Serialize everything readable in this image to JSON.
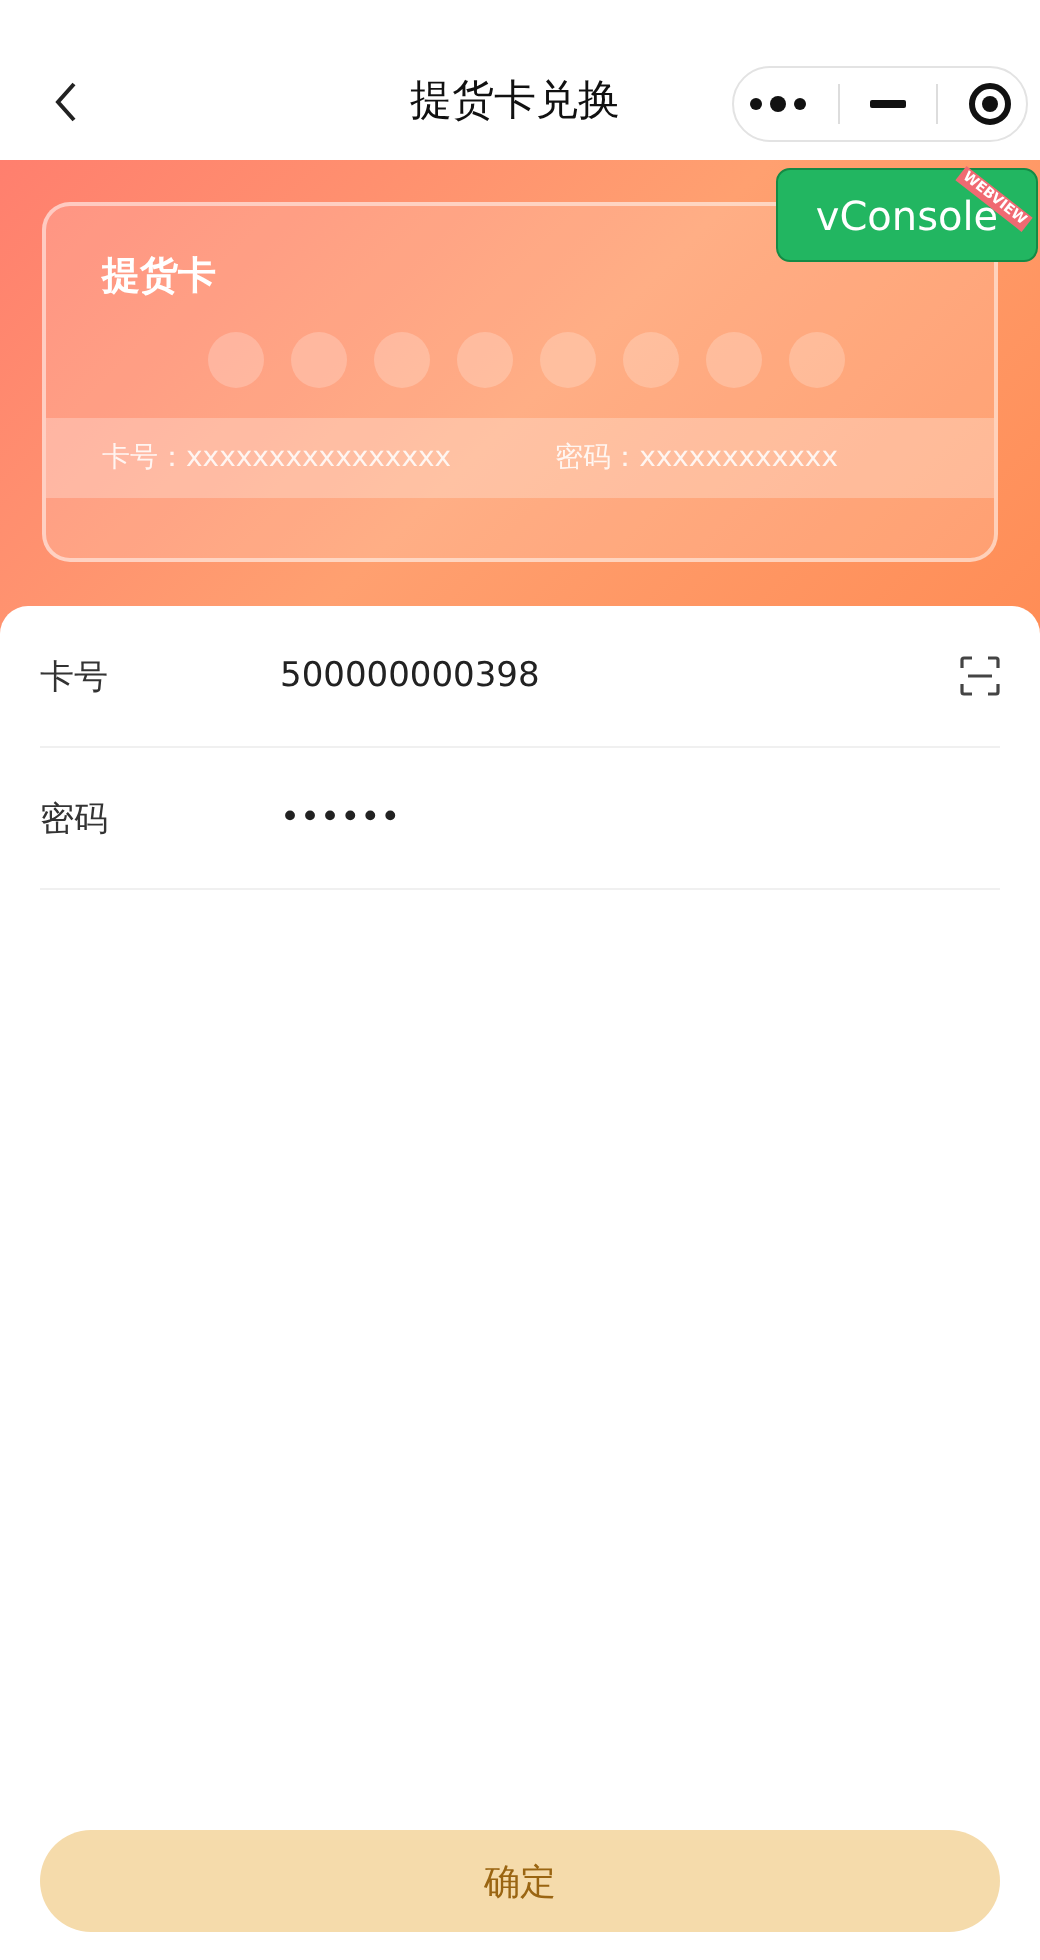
{
  "nav": {
    "title": "提货卡兑换"
  },
  "card": {
    "title": "提货卡",
    "number_label": "卡号：",
    "number": "xxxxxxxxxxxxxxxx",
    "password_label": "密码：",
    "password": "xxxxxxxxxxxx"
  },
  "vconsole": {
    "label": "vConsole",
    "ribbon": "WEBVIEW"
  },
  "form": [
    {
      "label": "卡号",
      "value": "500000000398",
      "kind": "scan"
    },
    {
      "label": "密码",
      "value": "••••••",
      "kind": "plain"
    }
  ],
  "submit": {
    "label": "确定"
  }
}
